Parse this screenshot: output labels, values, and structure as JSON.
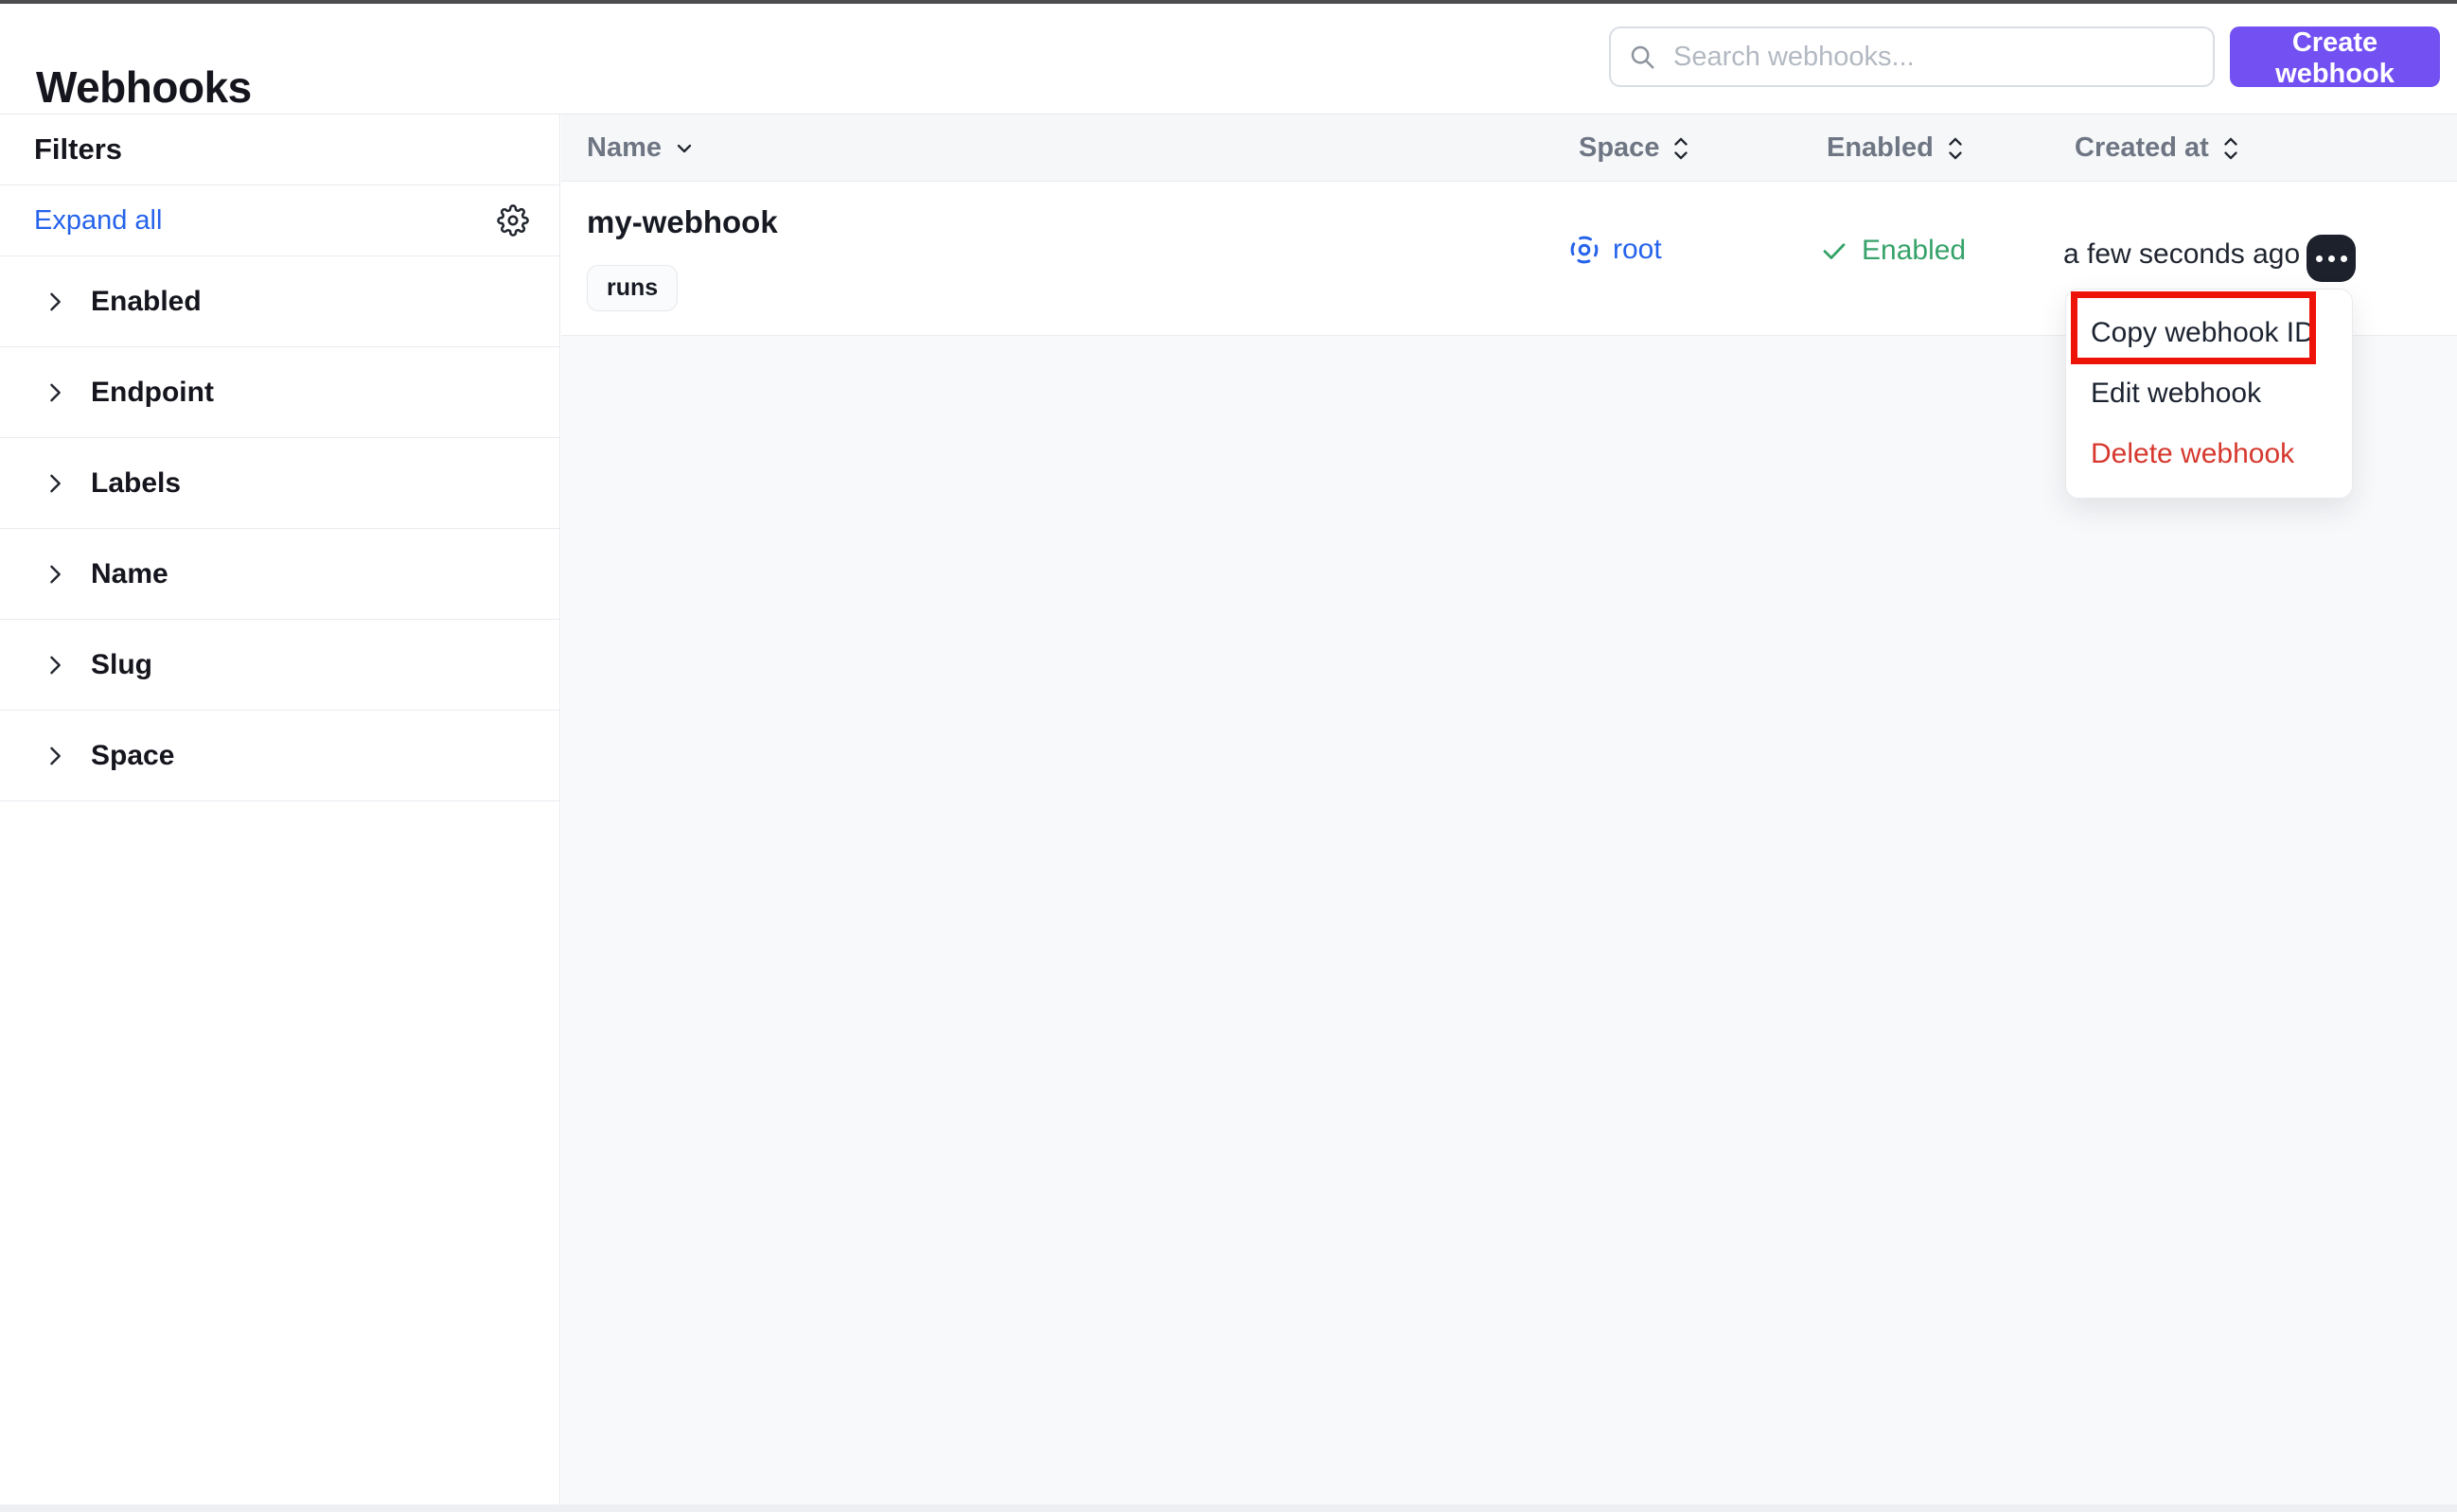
{
  "app": {
    "title": "Webhooks"
  },
  "header": {
    "search": {
      "placeholder": "Search webhooks...",
      "icon": "search-icon"
    },
    "create_button_label": "Create webhook"
  },
  "filters": {
    "title": "Filters",
    "expand_all_label": "Expand all",
    "settings_icon": "gear-icon",
    "sections": [
      {
        "label": "Enabled"
      },
      {
        "label": "Endpoint"
      },
      {
        "label": "Labels"
      },
      {
        "label": "Name"
      },
      {
        "label": "Slug"
      },
      {
        "label": "Space"
      }
    ]
  },
  "table": {
    "columns": [
      {
        "label": "Name",
        "sort_state": "sorted-desc"
      },
      {
        "label": "Space",
        "sort_state": "sortable"
      },
      {
        "label": "Enabled",
        "sort_state": "sortable"
      },
      {
        "label": "Created at",
        "sort_state": "sortable"
      }
    ],
    "rows": [
      {
        "name": "my-webhook",
        "tags": [
          "runs"
        ],
        "space": "root",
        "enabled_label": "Enabled",
        "created_at": "a few seconds ago"
      }
    ]
  },
  "context_menu": {
    "items": [
      {
        "label": "Copy webhook ID",
        "style": "default",
        "annotated": true
      },
      {
        "label": "Edit webhook",
        "style": "default",
        "annotated": false
      },
      {
        "label": "Delete webhook",
        "style": "danger",
        "annotated": false
      }
    ]
  },
  "colors": {
    "accent_purple": "#7350f2",
    "link_blue": "#2563eb",
    "success_green": "#36a269",
    "danger_red": "#d6382e",
    "annotation_red": "#ee1309",
    "table_header_bg": "#f6f7f9",
    "main_bg": "#f8f9fb"
  }
}
